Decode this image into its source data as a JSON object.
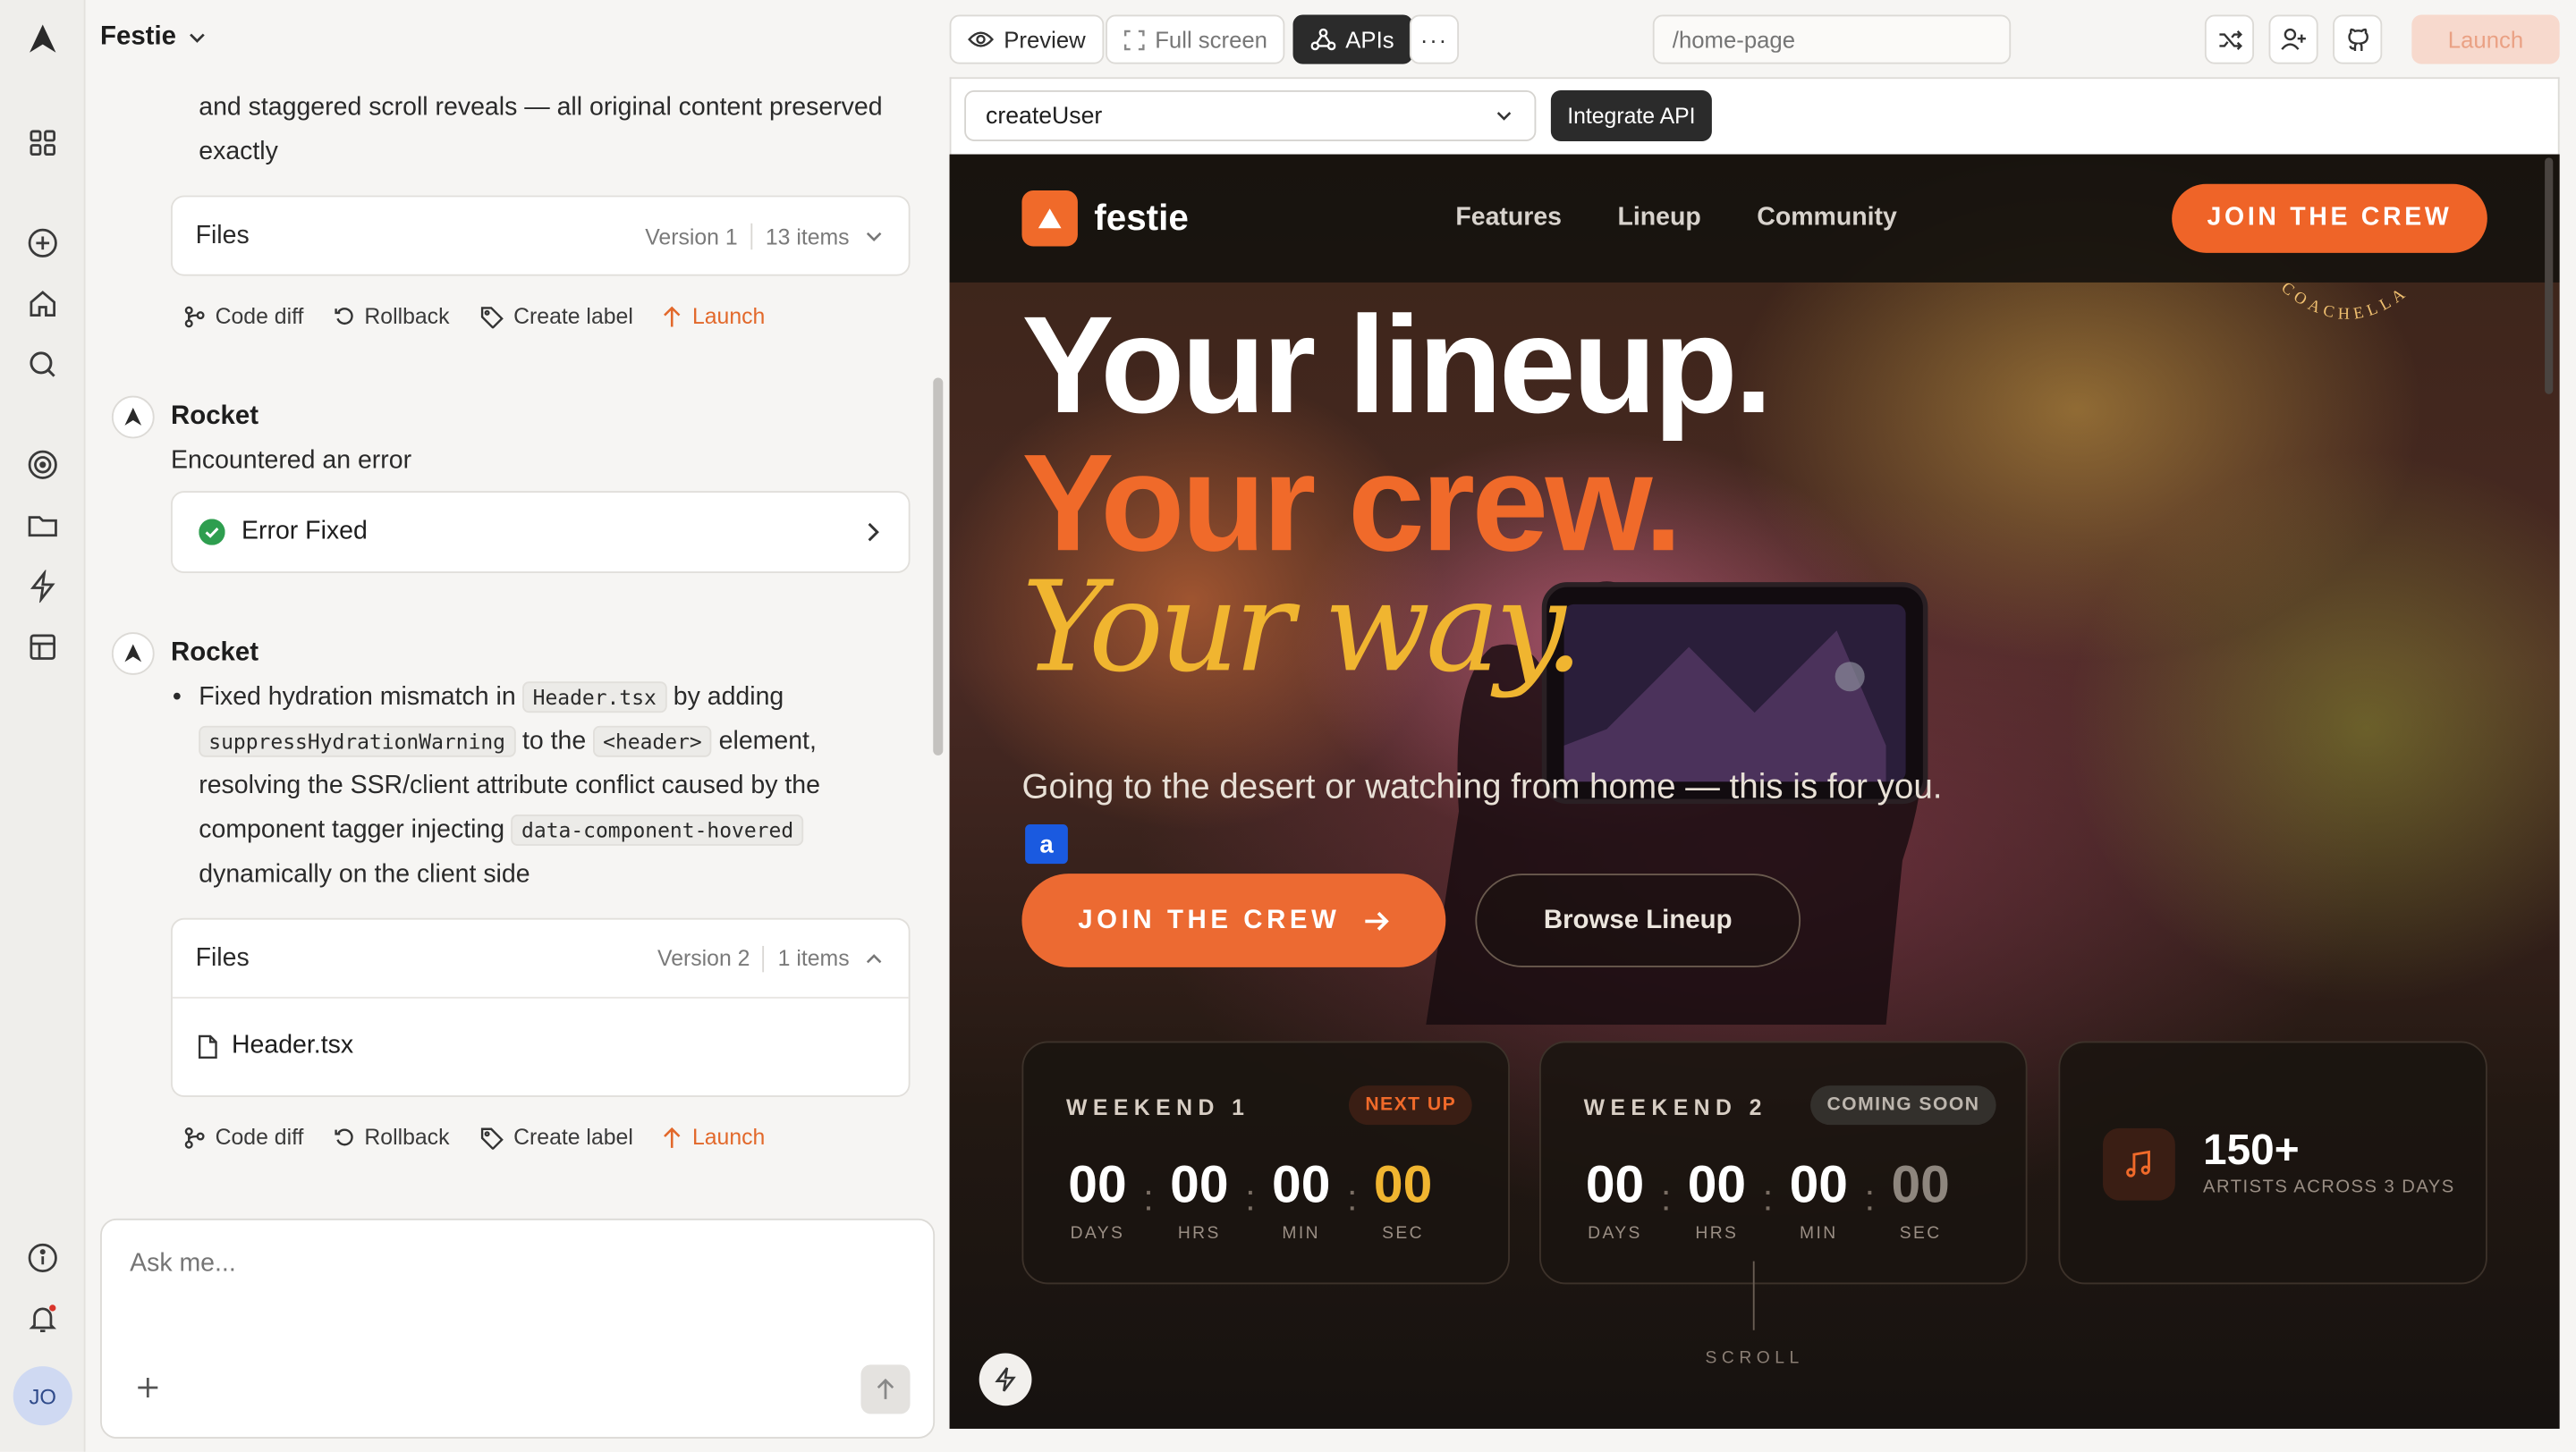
{
  "app": {
    "project_name": "Festie",
    "avatar_initials": "JO"
  },
  "chat": {
    "intro_text": "and staggered scroll reveals — all original content preserved exactly",
    "files1": {
      "title": "Files",
      "version": "Version 1",
      "count": "13 items"
    },
    "actions": {
      "code_diff": "Code diff",
      "rollback": "Rollback",
      "create_label": "Create label",
      "launch": "Launch"
    },
    "msg1": {
      "author": "Rocket",
      "text": "Encountered an error",
      "status": "Error Fixed"
    },
    "msg2": {
      "author": "Rocket",
      "bullet": {
        "t1": "Fixed hydration mismatch in ",
        "c1": "Header.tsx",
        "t2": " by adding ",
        "c2": "suppressHydrationWarning",
        "t3": " to the ",
        "c3": "<header>",
        "t4": " element, resolving the SSR/client attribute conflict caused by the component tagger injecting ",
        "c4": "data-component-hovered",
        "t5": " dynamically on the client side"
      }
    },
    "files2": {
      "title": "Files",
      "version": "Version 2",
      "count": "1 items",
      "file": "Header.tsx"
    },
    "composer_placeholder": "Ask me..."
  },
  "topbar": {
    "preview": "Preview",
    "fullscreen": "Full screen",
    "apis": "APIs",
    "url_placeholder": "/home-page",
    "launch": "Launch"
  },
  "api_bar": {
    "selected": "createUser",
    "integrate": "Integrate API"
  },
  "site": {
    "brand": "festie",
    "nav": [
      "Features",
      "Lineup",
      "Community"
    ],
    "nav_cta": "JOIN THE CREW",
    "badge_arc": "COACHELLA",
    "headline1": "Your lineup.",
    "headline2": "Your crew.",
    "headline3": "Your way.",
    "subhead": "Going to the desert or watching from home — this is for you.",
    "marker": "a",
    "cta_primary": "JOIN THE CREW",
    "cta_secondary": "Browse Lineup",
    "weekend1": {
      "label": "WEEKEND 1",
      "pill": "NEXT UP",
      "days": "00",
      "hrs": "00",
      "min": "00",
      "sec": "00"
    },
    "weekend2": {
      "label": "WEEKEND 2",
      "pill": "COMING SOON",
      "days": "00",
      "hrs": "00",
      "min": "00",
      "sec": "00"
    },
    "units": {
      "days": "DAYS",
      "hrs": "HRS",
      "min": "MIN",
      "sec": "SEC"
    },
    "artists": {
      "value": "150+",
      "label": "ARTISTS ACROSS 3 DAYS"
    },
    "scroll": "SCROLL"
  },
  "colors": {
    "accent": "#ef6428",
    "launch_text": "#e2682a",
    "yellow": "#f0b530",
    "success": "#2e9e4f"
  }
}
